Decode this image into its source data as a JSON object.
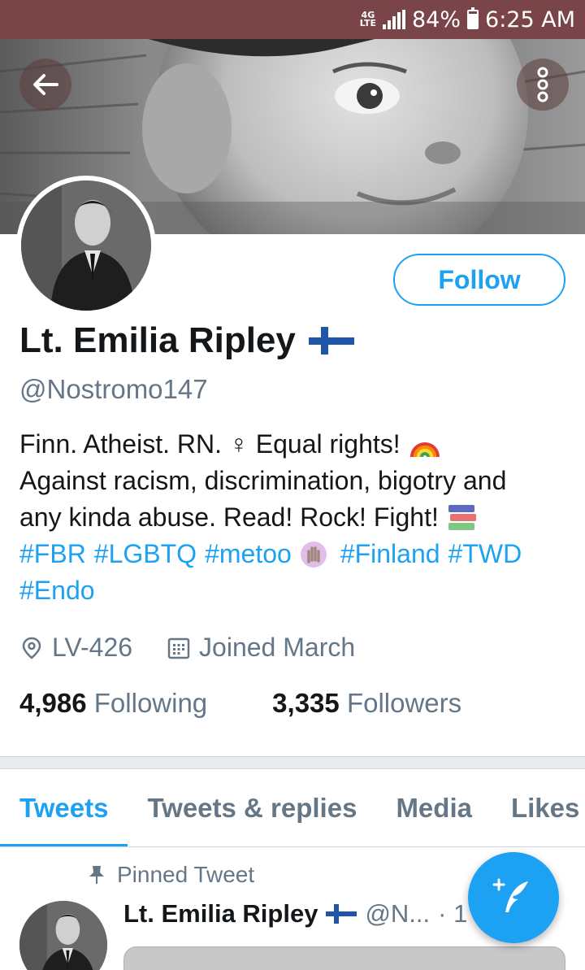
{
  "status_bar": {
    "network": "4G LTE",
    "battery_percent": "84%",
    "battery_level": 0.84,
    "time": "6:25 AM"
  },
  "header": {
    "back_icon": "arrow-left-icon",
    "more_icon": "vertical-dots-icon"
  },
  "profile": {
    "follow_label": "Follow",
    "display_name": "Lt. Emilia Ripley",
    "name_emoji": "finland-flag",
    "handle": "@Nostromo147",
    "bio": {
      "line1": "Finn. Atheist. RN. ♀ Equal rights!",
      "line1_emoji": "rainbow",
      "line2": "Against racism, discrimination, bigotry and",
      "line3": "any kinda abuse. Read! Rock! Fight!",
      "line3_emoji": "books",
      "hashtags_line1": [
        "#FBR",
        "#LGBTQ",
        "#metoo",
        "#Finland",
        "#TWD"
      ],
      "metoo_emoji": "raised-hand",
      "hashtags_line2": [
        "#Endo"
      ]
    },
    "location": "LV-426",
    "joined": "Joined March",
    "following_count": "4,986",
    "following_label": "Following",
    "followers_count": "3,335",
    "followers_label": "Followers"
  },
  "tabs": [
    {
      "label": "Tweets",
      "active": true
    },
    {
      "label": "Tweets & replies",
      "active": false
    },
    {
      "label": "Media",
      "active": false
    },
    {
      "label": "Likes",
      "active": false
    }
  ],
  "pinned_tweet": {
    "pinned_label": "Pinned Tweet",
    "author_name": "Lt. Emilia Ripley",
    "author_handle": "@N...",
    "separator": "· 1"
  },
  "fab": {
    "icon": "compose-feather-icon"
  },
  "colors": {
    "status_bar": "#7a4548",
    "accent": "#1da1f2",
    "secondary_text": "#657786",
    "divider": "#e6ecf0"
  }
}
